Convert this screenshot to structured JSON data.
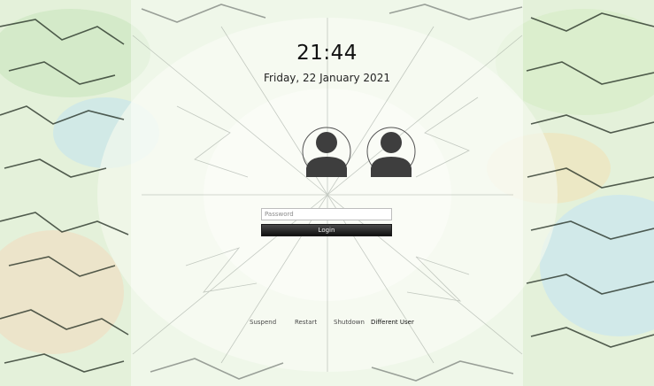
{
  "lockscreen": {
    "time": "21:44",
    "date": "Friday, 22 January 2021"
  },
  "users": [
    {
      "icon": "user-avatar-icon"
    },
    {
      "icon": "user-avatar-icon"
    }
  ],
  "login": {
    "password_placeholder": "Password",
    "password_value": "",
    "button_label": "Login"
  },
  "actions": {
    "suspend": "Suspend",
    "restart": "Restart",
    "shutdown": "Shutdown",
    "different_user": "Different User"
  },
  "colors": {
    "button_bg": "#1e1e1e",
    "avatar_fill": "#3e3e3e"
  }
}
